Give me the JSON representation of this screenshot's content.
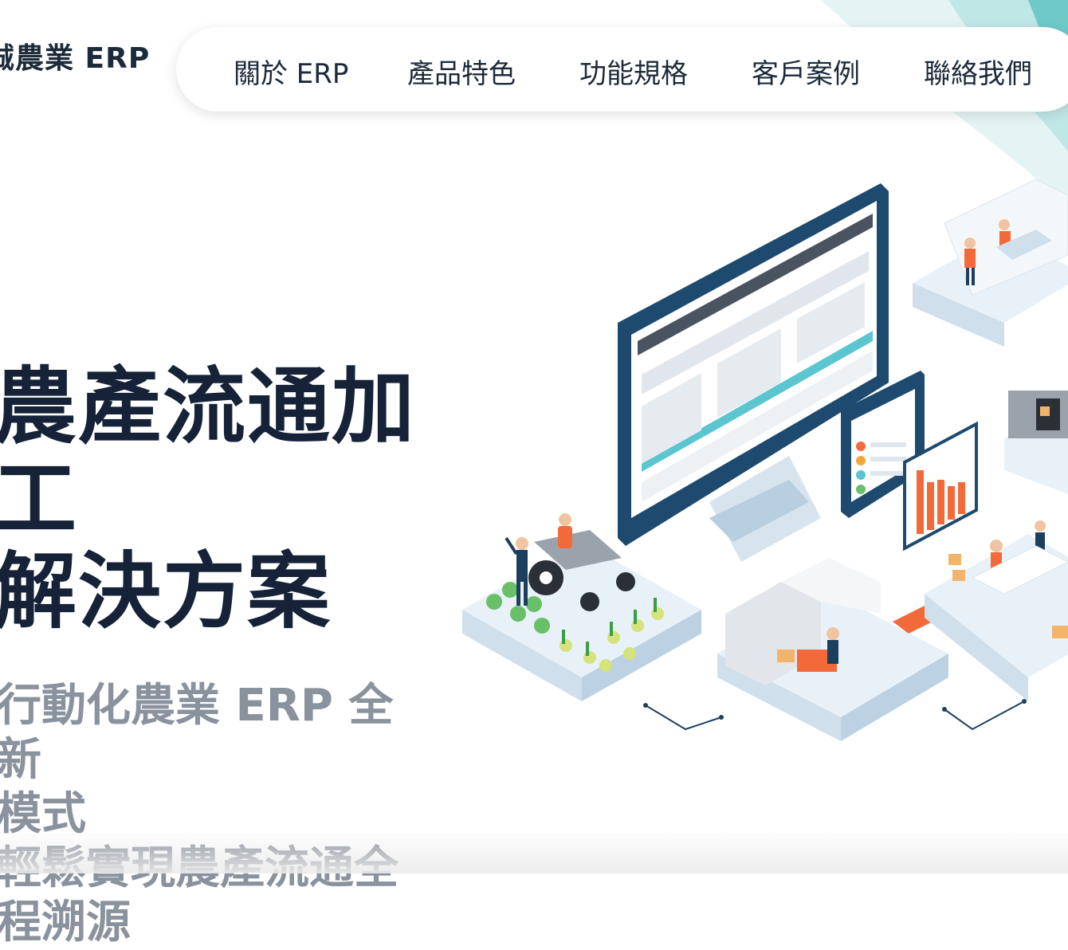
{
  "header": {
    "logo_text": "誠農業 ERP"
  },
  "nav": {
    "items": [
      {
        "label": "關於 ERP"
      },
      {
        "label": "產品特色"
      },
      {
        "label": "功能規格"
      },
      {
        "label": "客戶案例"
      },
      {
        "label": "聯絡我們"
      }
    ]
  },
  "hero": {
    "title_lines": [
      "農產流通加",
      "工",
      "解決方案"
    ],
    "subtitle_lines": [
      "行動化農業 ERP 全新",
      "模式",
      "輕鬆實現農產流通全",
      "程溯源"
    ]
  },
  "colors": {
    "accent_teal": "#5cc6d0",
    "navy": "#1d3f5e",
    "orange": "#f26a3a",
    "light_blue": "#dce9f3"
  }
}
